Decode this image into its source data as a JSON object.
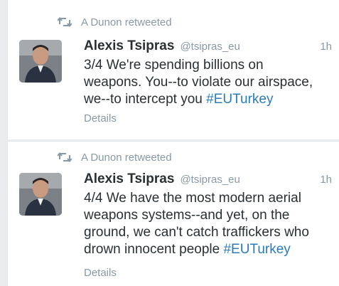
{
  "colors": {
    "background": "#e9ebee",
    "card": "#ffffff",
    "text": "#292f33",
    "muted": "#8899a6",
    "hashtag": "#2b7bb9"
  },
  "tweets": [
    {
      "context_icon": "retweet-icon",
      "context": "A Dunon retweeted",
      "fullname": "Alexis Tsipras",
      "username": "@tsipras_eu",
      "time": "1h",
      "text_lines": [
        "3/4 We're spending billions on",
        "weapons. You--to violate our airspace,",
        "we--to intercept you "
      ],
      "hashtag": "#EUTurkey",
      "details": "Details"
    },
    {
      "context_icon": "retweet-icon",
      "context": "A Dunon retweeted",
      "fullname": "Alexis Tsipras",
      "username": "@tsipras_eu",
      "time": "1h",
      "text_lines": [
        "4/4 We have the most modern aerial",
        "weapons systems--and yet, on the",
        "ground, we can't catch traffickers who",
        "drown innocent people "
      ],
      "hashtag": "#EUTurkey",
      "details": "Details"
    }
  ]
}
